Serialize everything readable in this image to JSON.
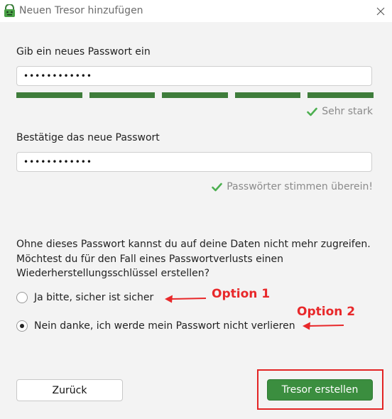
{
  "window": {
    "title": "Neuen Tresor hinzufügen",
    "app_icon": "cryptomator-icon",
    "close_icon": "close-icon"
  },
  "password": {
    "label": "Gib ein neues Passwort ein",
    "value": "••••••••••••",
    "strength_segments": 5,
    "strength_filled": 5,
    "strength_color": "#3e7d3b",
    "strength_text": "Sehr stark"
  },
  "confirm": {
    "label": "Bestätige das neue Passwort",
    "value": "••••••••••••",
    "match_text": "Passwörter stimmen überein!"
  },
  "recovery": {
    "question_lines": [
      "Ohne dieses Passwort kannst du auf deine Daten nicht mehr zugreifen.",
      "Möchtest du für den Fall eines Passwortverlusts einen",
      "Wiederherstellungsschlüssel erstellen?"
    ],
    "options": [
      {
        "label": "Ja bitte, sicher ist sicher",
        "selected": false
      },
      {
        "label": "Nein danke, ich werde mein Passwort nicht verlieren",
        "selected": true
      }
    ]
  },
  "annotations": {
    "option1": "Option 1",
    "option2": "Option 2",
    "color": "#e8282a"
  },
  "buttons": {
    "back": "Zurück",
    "create": "Tresor erstellen"
  },
  "colors": {
    "accent_green": "#3b8e3f",
    "check_green": "#4caf50"
  }
}
